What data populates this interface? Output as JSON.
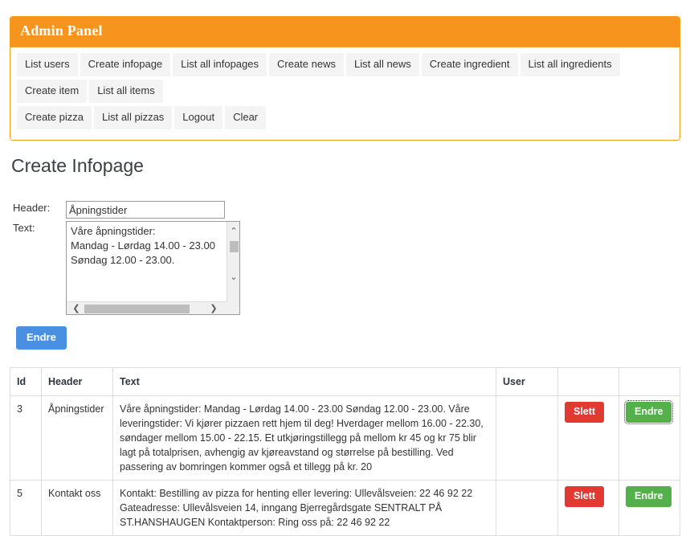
{
  "panel": {
    "title": "Admin Panel",
    "nav_row_1": [
      "List users",
      "Create infopage",
      "List all infopages",
      "Create news",
      "List all news",
      "Create ingredient",
      "List all ingredients",
      "Create item",
      "List all items"
    ],
    "nav_row_2": [
      "Create pizza",
      "List all pizzas",
      "Logout",
      "Clear"
    ],
    "accent_color": "#f7941e"
  },
  "page": {
    "title": "Create Infopage"
  },
  "form": {
    "header_label": "Header:",
    "header_value": "Åpningstider",
    "text_label": "Text:",
    "text_value": "Våre åpningstider:\nMandag - Lørdag 14.00 - 23.00\nSøndag 12.00 - 23.00.",
    "submit_label": "Endre",
    "submit_color": "#4a90e2",
    "scroll_up_icon": "chevron-up-icon",
    "scroll_down_icon": "chevron-down-icon",
    "scroll_left_icon": "chevron-left-icon",
    "scroll_right_icon": "chevron-right-icon",
    "scroll_up_glyph": "⌃",
    "scroll_down_glyph": "⌄",
    "scroll_left_glyph": "❮",
    "scroll_right_glyph": "❯"
  },
  "table": {
    "columns": [
      "Id",
      "Header",
      "Text",
      "User",
      "",
      ""
    ],
    "delete_label": "Slett",
    "edit_label": "Endre",
    "delete_color": "#e03a32",
    "edit_color": "#54b04a",
    "rows": [
      {
        "id": "3",
        "header": "Åpningstider",
        "text": "Våre åpningstider: Mandag - Lørdag 14.00 - 23.00 Søndag 12.00 - 23.00. Våre leveringstider: Vi kjører pizzaen rett hjem til deg! Hverdager mellom 16.00 - 22.30, søndager mellom 15.00 - 22.15. Et utkjøringstillegg på mellom kr 45 og kr 75 blir lagt på totalprisen, avhengig av kjøreavstand og størrelse på bestilling. Ved passering av bomringen kommer også et tillegg på kr. 20",
        "user": ""
      },
      {
        "id": "5",
        "header": "Kontakt oss",
        "text": "Kontakt: Bestilling av pizza for henting eller levering: Ullevålsveien: 22 46 92 22 Gateadresse: Ullevålsveien 14, inngang Bjerregårdsgate SENTRALT PÅ ST.HANSHAUGEN Kontaktperson: Ring oss på: 22 46 92 22",
        "user": ""
      }
    ]
  }
}
